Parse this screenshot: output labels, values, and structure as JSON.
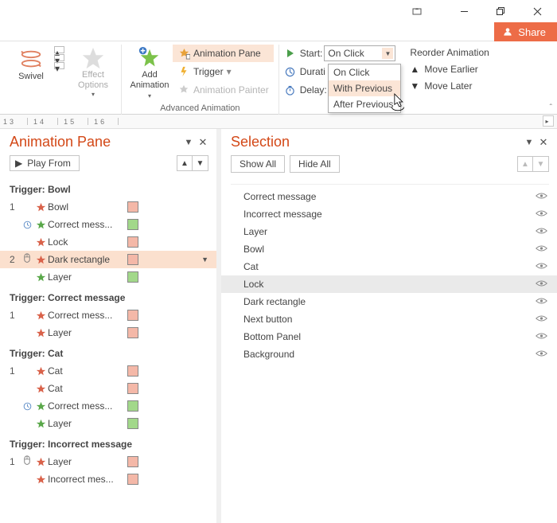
{
  "share": {
    "label": "Share"
  },
  "ribbon": {
    "swivel": {
      "label": "Swivel"
    },
    "effect_options": {
      "line1": "Effect",
      "line2": "Options"
    },
    "add_animation": {
      "line1": "Add",
      "line2": "Animation"
    },
    "animation_pane": "Animation Pane",
    "trigger": "Trigger",
    "animation_painter": "Animation Painter",
    "advanced_label": "Advanced Animation",
    "timing": {
      "start_label": "Start:",
      "start_value": "On Click",
      "duration_label": "Durati",
      "delay_label": "Delay:"
    },
    "start_options": {
      "on_click": "On Click",
      "with_previous": "With Previous",
      "after_previous": "After Previous"
    },
    "reorder": {
      "title": "Reorder Animation",
      "earlier": "Move Earlier",
      "later": "Move Later"
    }
  },
  "ruler": {
    "nums": [
      "13",
      "14",
      "15",
      "16"
    ]
  },
  "anim_pane": {
    "title": "Animation Pane",
    "play_from": "Play From",
    "triggers": [
      {
        "label": "Trigger: Bowl",
        "items": [
          {
            "num": "1",
            "timing": "",
            "star": "red",
            "name": "Bowl",
            "color": "#f4b8a8"
          },
          {
            "num": "",
            "timing": "clock",
            "star": "green",
            "name": "Correct mess...",
            "color": "#a2d88a"
          },
          {
            "num": "",
            "timing": "",
            "star": "red",
            "name": "Lock",
            "color": "#f4b8a8"
          },
          {
            "num": "2",
            "timing": "mouse",
            "star": "red",
            "name": "Dark rectangle",
            "color": "#f4b8a8",
            "selected": true
          },
          {
            "num": "",
            "timing": "",
            "star": "green",
            "name": "Layer",
            "color": "#a2d88a"
          }
        ]
      },
      {
        "label": "Trigger: Correct message",
        "items": [
          {
            "num": "1",
            "timing": "",
            "star": "red",
            "name": "Correct mess...",
            "color": "#f4b8a8"
          },
          {
            "num": "",
            "timing": "",
            "star": "red",
            "name": "Layer",
            "color": "#f4b8a8"
          }
        ]
      },
      {
        "label": "Trigger: Cat",
        "items": [
          {
            "num": "1",
            "timing": "",
            "star": "red",
            "name": "Cat",
            "color": "#f4b8a8"
          },
          {
            "num": "",
            "timing": "",
            "star": "red",
            "name": "Cat",
            "color": "#f4b8a8"
          },
          {
            "num": "",
            "timing": "clock",
            "star": "green",
            "name": "Correct mess...",
            "color": "#a2d88a"
          },
          {
            "num": "",
            "timing": "",
            "star": "green",
            "name": "Layer",
            "color": "#a2d88a"
          }
        ]
      },
      {
        "label": "Trigger: Incorrect message",
        "items": [
          {
            "num": "1",
            "timing": "mouse",
            "star": "red",
            "name": "Layer",
            "color": "#f4b8a8"
          },
          {
            "num": "",
            "timing": "",
            "star": "red",
            "name": "Incorrect mes...",
            "color": "#f4b8a8"
          }
        ]
      }
    ]
  },
  "selection": {
    "title": "Selection",
    "show_all": "Show All",
    "hide_all": "Hide All",
    "items": [
      {
        "name": "Correct message"
      },
      {
        "name": "Incorrect message"
      },
      {
        "name": "Layer"
      },
      {
        "name": "Bowl"
      },
      {
        "name": "Cat"
      },
      {
        "name": "Lock",
        "hover": true
      },
      {
        "name": "Dark rectangle"
      },
      {
        "name": "Next button"
      },
      {
        "name": "Bottom Panel"
      },
      {
        "name": "Background"
      }
    ]
  }
}
